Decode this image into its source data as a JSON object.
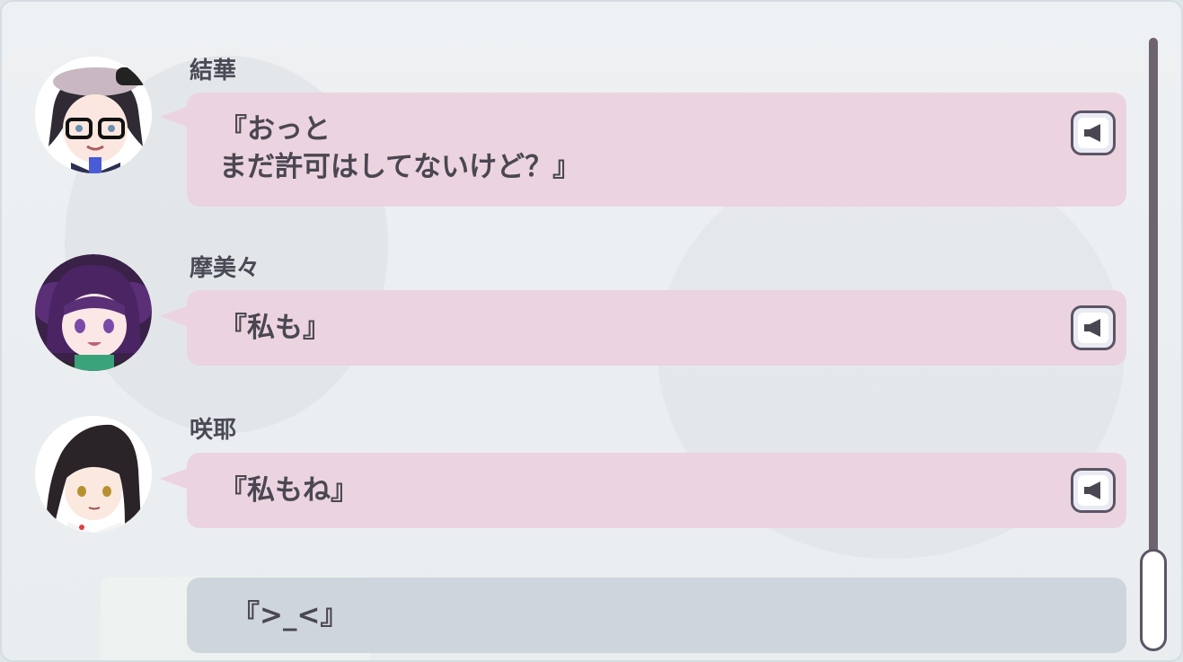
{
  "log": [
    {
      "speaker": "結華",
      "lines": [
        "『おっと",
        "まだ許可はしてないけど？』"
      ],
      "voice_icon": "speaker-icon"
    },
    {
      "speaker": "摩美々",
      "lines": [
        "『私も』"
      ],
      "voice_icon": "speaker-icon"
    },
    {
      "speaker": "咲耶",
      "lines": [
        "『私もね』"
      ],
      "voice_icon": "speaker-icon"
    }
  ],
  "player_line": "『>_<』",
  "colors": {
    "bubble": "#ebd4df",
    "player_bubble": "#cfd5dc",
    "text": "#4a4752",
    "scroll_track": "#6e6470"
  }
}
